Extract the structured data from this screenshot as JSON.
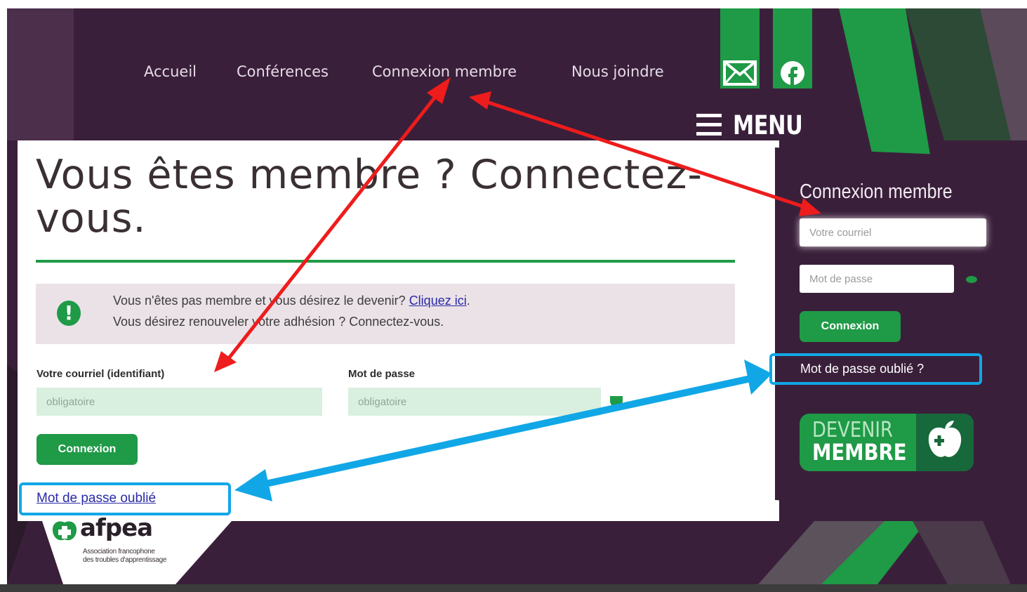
{
  "nav": {
    "items": [
      "Accueil",
      "Conférences",
      "Connexion membre",
      "Nous joindre"
    ],
    "menu_label": "MENU"
  },
  "main": {
    "heading": "Vous êtes membre ? Connectez-vous.",
    "notice": {
      "line1_text": "Vous n'êtes pas membre et vous désirez le devenir?",
      "line1_link": "Cliquez ici",
      "line1_end": ".",
      "line2": "Vous désirez renouveler votre adhésion ? Connectez-vous."
    },
    "email_label": "Votre courriel (identifiant)",
    "email_placeholder": "obligatoire",
    "password_label": "Mot de passe",
    "password_placeholder": "obligatoire",
    "login_button": "Connexion",
    "forgot_link": "Mot de passe oublié"
  },
  "logo": {
    "name": "afpea",
    "line1": "Association francophone",
    "line2": "des troubles d'apprentissage"
  },
  "side": {
    "title": "Connexion membre",
    "email_placeholder": "Votre courriel",
    "password_placeholder": "Mot de passe",
    "login_button": "Connexion",
    "forgot_link": "Mot de passe oublié ?",
    "join_line1": "DEVENIR",
    "join_line2": "MEMBRE"
  },
  "colors": {
    "header_bg": "#3a1f3a",
    "accent_green": "#1f9a46",
    "arrow_red": "#ee1c1c",
    "highlight_blue": "#11a7e6"
  }
}
